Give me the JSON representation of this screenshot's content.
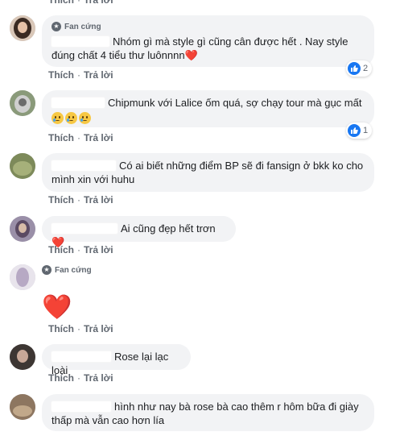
{
  "actions": {
    "like": "Thích",
    "reply": "Trả lời",
    "sep": "·"
  },
  "colors": {
    "bubble": "#f2f3f5",
    "like_blue": "#1877f2",
    "meta_gray": "#606770",
    "heart": "#e0245e"
  },
  "comments": [
    {
      "badge": "Fan cứng",
      "text": "Nhóm gì mà style gì cũng cân được hết . Nay style đúng chất 4 tiểu thư luônnnn",
      "trailing_emoji": "❤️",
      "reactions": {
        "icon": "like-icon",
        "count": "2"
      }
    },
    {
      "text": "Chipmunk với Lalice ốm quá, sợ chạy tour mà gục mất",
      "emojis": [
        "crying-face-icon",
        "crying-face-icon",
        "crying-face-icon"
      ],
      "reactions": {
        "icon": "like-icon",
        "count": "1"
      }
    },
    {
      "text": "Có ai biết những điểm BP sẽ đi fansign ở bkk ko cho mình xin với huhu"
    },
    {
      "text": "Ai cũng đẹp hết trơn",
      "trailing_emoji": "❤️"
    },
    {
      "badge": "Fan cứng",
      "big_emoji": "❤️"
    },
    {
      "text": "Rose lại lạc loài"
    },
    {
      "text": "hình như nay bà rose bà cao thêm r hôm bữa đi giày thấp mà vẫn cao hơn lía"
    }
  ]
}
